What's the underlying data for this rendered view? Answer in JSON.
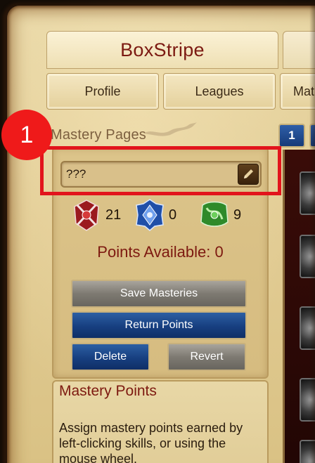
{
  "header": {
    "summoner_name": "BoxStripe"
  },
  "nav": [
    {
      "label": "Profile"
    },
    {
      "label": "Leagues"
    },
    {
      "label": "Mat"
    }
  ],
  "mastery_pages": {
    "label": "Mastery Pages",
    "page_numbers": [
      "1"
    ],
    "page_name_value": "???"
  },
  "annotation": {
    "step_number": "1",
    "highlight_color": "#e2141c"
  },
  "trees": [
    {
      "icon": "offense-tree-icon",
      "count": "21",
      "color": "#c0252a"
    },
    {
      "icon": "defense-tree-icon",
      "count": "0",
      "color": "#2a63c8"
    },
    {
      "icon": "utility-tree-icon",
      "count": "9",
      "color": "#3fa63a"
    }
  ],
  "points_available": "Points Available: 0",
  "buttons": {
    "save": "Save Masteries",
    "return_points": "Return Points",
    "delete": "Delete",
    "revert": "Revert"
  },
  "mastery_points": {
    "title": "Mastery Points",
    "description": "Assign mastery points earned by left-clicking skills, or using the mouse wheel."
  }
}
